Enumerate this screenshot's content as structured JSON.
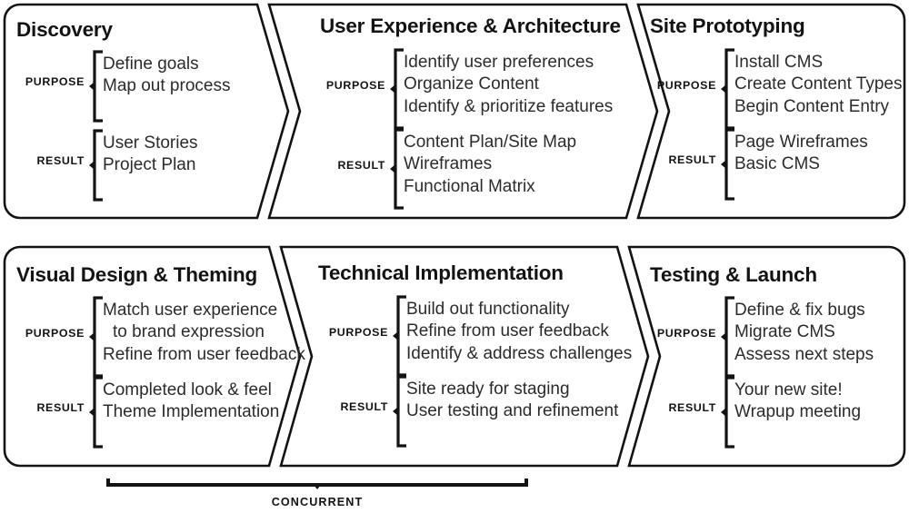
{
  "diagram": {
    "title_hidden": "",
    "rows": [
      {
        "row_name": "phase-row-1",
        "panels": [
          {
            "id": "discovery",
            "title": "Discovery",
            "sections": [
              {
                "label": "PURPOSE",
                "items": [
                  "Define goals",
                  "Map out process"
                ]
              },
              {
                "label": "RESULT",
                "items": [
                  "User Stories",
                  "Project Plan"
                ]
              }
            ]
          },
          {
            "id": "user-experience-architecture",
            "title": "User Experience & Architecture",
            "sections": [
              {
                "label": "PURPOSE",
                "items": [
                  "Identify user preferences",
                  "Organize Content",
                  "Identify & prioritize features"
                ]
              },
              {
                "label": "RESULT",
                "items": [
                  "Content Plan/Site Map",
                  "Wireframes",
                  "Functional Matrix"
                ]
              }
            ]
          },
          {
            "id": "site-prototyping",
            "title": "Site Prototyping",
            "sections": [
              {
                "label": "PURPOSE",
                "items": [
                  "Install CMS",
                  "Create Content Types",
                  "Begin Content Entry"
                ]
              },
              {
                "label": "RESULT",
                "items": [
                  "Page Wireframes",
                  "Basic CMS"
                ]
              }
            ]
          }
        ]
      },
      {
        "row_name": "phase-row-2",
        "panels": [
          {
            "id": "visual-design-theming",
            "title": "Visual Design & Theming",
            "sections": [
              {
                "label": "PURPOSE",
                "items": [
                  "Match user experience",
                  "to brand expression",
                  "Refine from user feedback"
                ]
              },
              {
                "label": "RESULT",
                "items": [
                  "Completed look & feel",
                  "Theme Implementation"
                ]
              }
            ]
          },
          {
            "id": "technical-implementation",
            "title": "Technical Implementation",
            "sections": [
              {
                "label": "PURPOSE",
                "items": [
                  "Build out functionality",
                  "Refine from user feedback",
                  "Identify & address challenges"
                ]
              },
              {
                "label": "RESULT",
                "items": [
                  "Site ready for staging",
                  "User testing and refinement"
                ]
              }
            ]
          },
          {
            "id": "testing-launch",
            "title": "Testing & Launch",
            "sections": [
              {
                "label": "PURPOSE",
                "items": [
                  "Define & fix bugs",
                  "Migrate CMS",
                  "Assess next steps"
                ]
              },
              {
                "label": "RESULT",
                "items": [
                  "Your new site!",
                  "Wrapup meeting"
                ]
              }
            ]
          }
        ]
      }
    ],
    "concurrent": {
      "label": "CONCURRENT"
    },
    "colors": {
      "stroke": "#131313",
      "background": "#ffffff",
      "title_text": "#131313",
      "body_text": "#2b2b2b"
    }
  }
}
